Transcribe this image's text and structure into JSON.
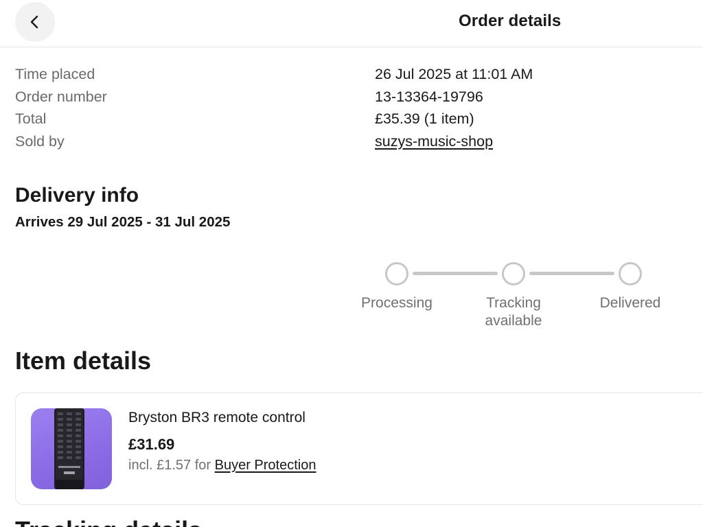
{
  "header": {
    "back_icon": "chevron-left-icon",
    "title": "Order details"
  },
  "summary": {
    "rows": [
      {
        "label": "Time placed",
        "value": "26 Jul 2025 at 11:01 AM"
      },
      {
        "label": "Order number",
        "value": "13-13364-19796"
      },
      {
        "label": "Total",
        "value": "£35.39 (1 item)"
      },
      {
        "label": "Sold by",
        "value": "suzys-music-shop"
      }
    ]
  },
  "delivery": {
    "title": "Delivery info",
    "arrives": "Arrives 29 Jul 2025 - 31 Jul 2025",
    "steps": [
      {
        "line1": "Processing",
        "line2": ""
      },
      {
        "line1": "Tracking",
        "line2": "available"
      },
      {
        "line1": "Delivered",
        "line2": ""
      }
    ]
  },
  "items": {
    "title": "Item details",
    "list": [
      {
        "name": "Bryston BR3 remote control",
        "price": "£31.69",
        "note_prefix": "incl. £1.57 for ",
        "note_link": "Buyer Protection"
      }
    ]
  },
  "tracking": {
    "title": "Tracking details"
  },
  "colors": {
    "text": "#191919",
    "muted": "#707070",
    "divider": "#e5e5e5",
    "step_inactive": "#c7c7c7",
    "thumbnail_bg": "#8d6de6"
  }
}
